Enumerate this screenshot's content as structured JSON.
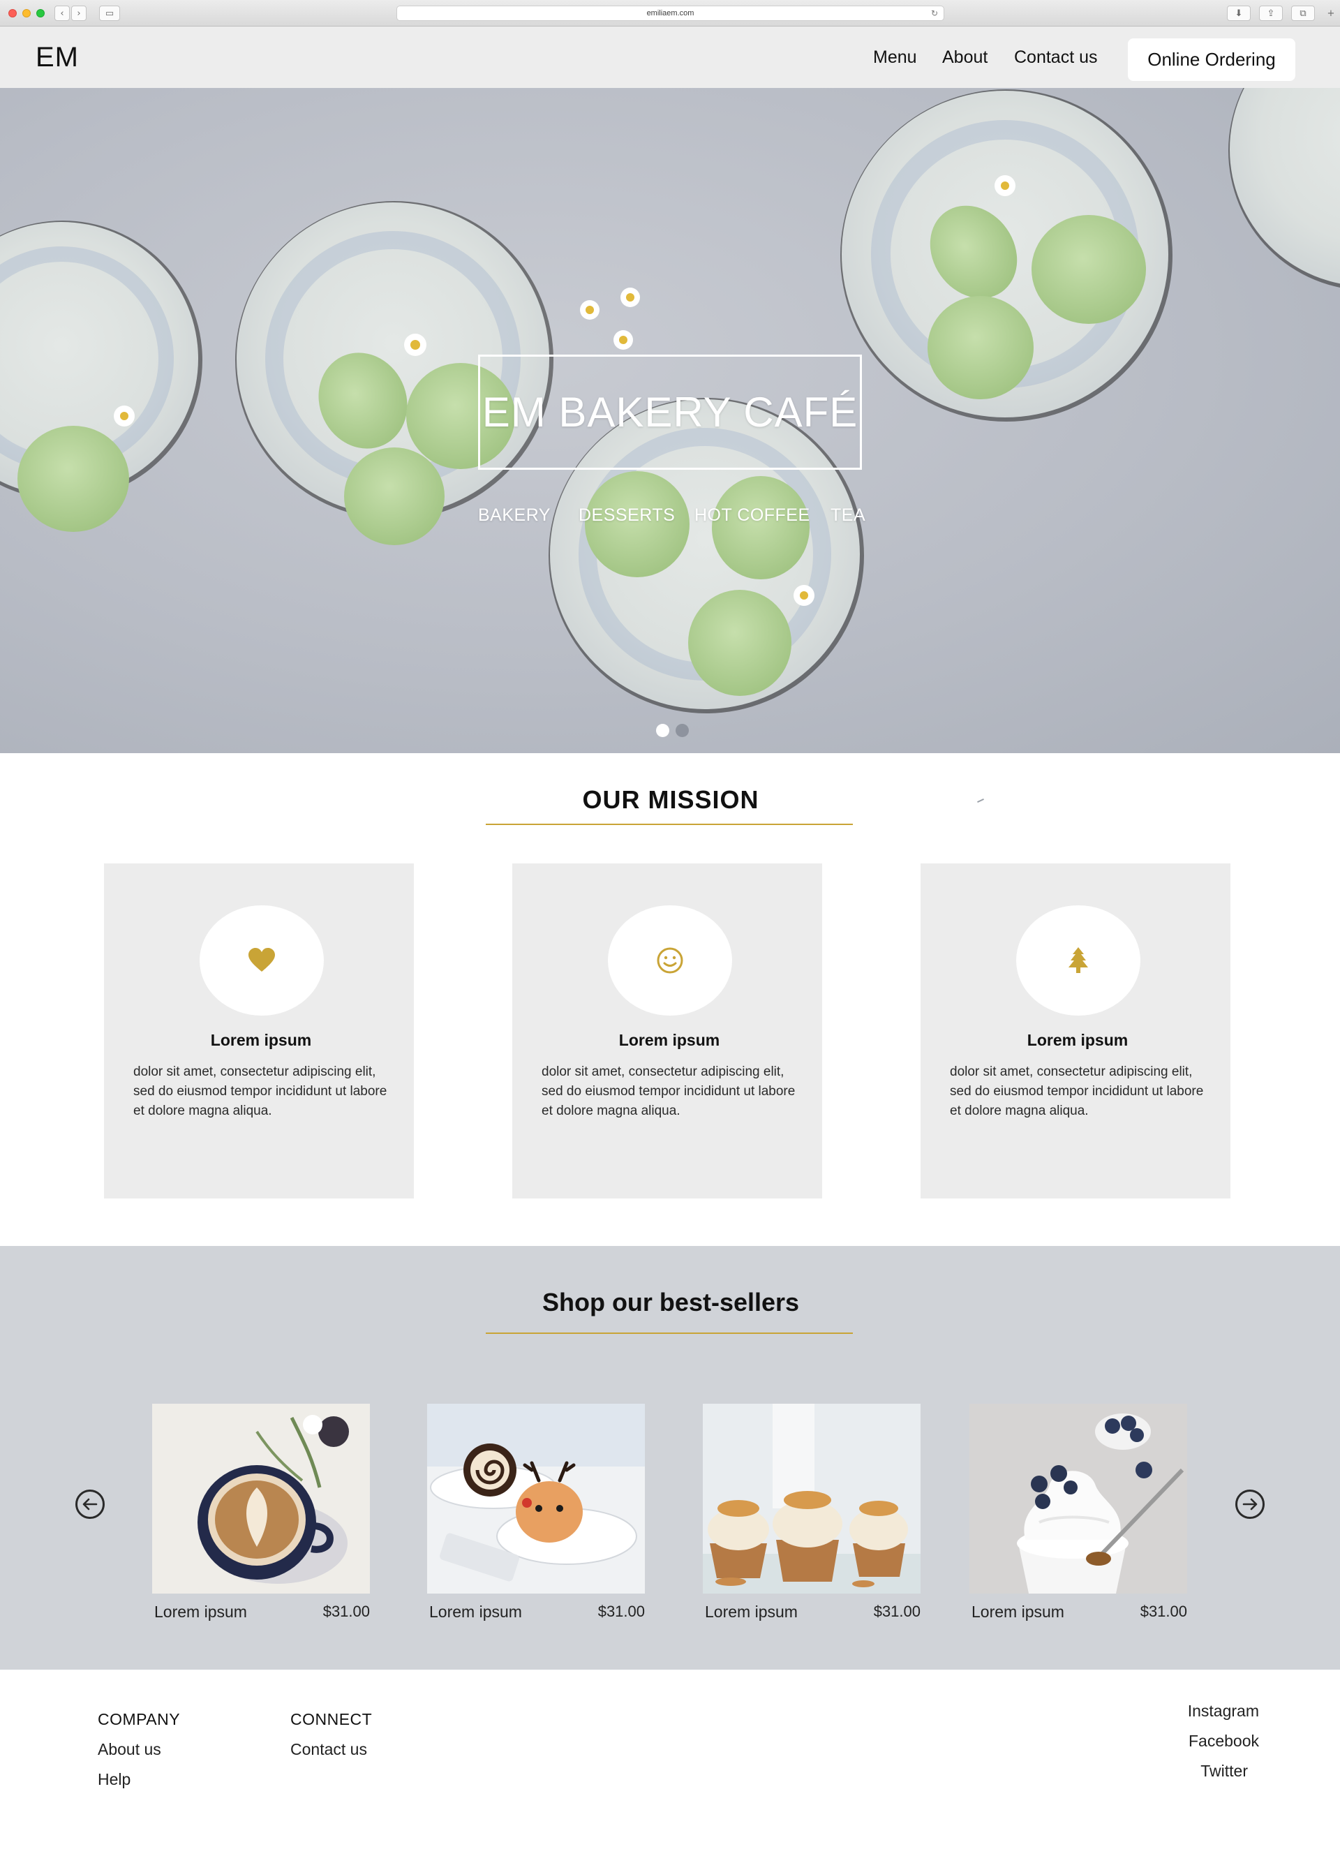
{
  "browser": {
    "url": "emiliaem.com"
  },
  "header": {
    "logo": "EM",
    "nav": [
      "Menu",
      "About",
      "Contact us"
    ],
    "cta": "Online Ordering"
  },
  "hero": {
    "title": "EM BAKERY CAFÉ",
    "categories": [
      "BAKERY",
      "DESSERTS",
      "HOT COFFEE",
      "TEA"
    ],
    "slide_count": 2,
    "active_slide": 1
  },
  "mission": {
    "title": "OUR MISSION",
    "cards": [
      {
        "icon": "heart-icon",
        "heading": "Lorem ipsum",
        "body": "dolor sit amet, consectetur adipiscing elit, sed do eiusmod tempor incididunt ut labore et dolore magna aliqua."
      },
      {
        "icon": "smiley-icon",
        "heading": "Lorem ipsum",
        "body": "dolor sit amet, consectetur adipiscing elit, sed do eiusmod tempor incididunt ut labore et dolore magna aliqua."
      },
      {
        "icon": "tree-icon",
        "heading": "Lorem ipsum",
        "body": "dolor sit amet, consectetur adipiscing elit, sed do eiusmod tempor incididunt ut labore et dolore magna aliqua."
      }
    ]
  },
  "sellers": {
    "title": "Shop our best-sellers",
    "products": [
      {
        "name": "Lorem ipsum",
        "price": "$31.00",
        "image": "latte-photo"
      },
      {
        "name": "Lorem ipsum",
        "price": "$31.00",
        "image": "cake-roll-photo"
      },
      {
        "name": "Lorem ipsum",
        "price": "$31.00",
        "image": "cupcakes-photo"
      },
      {
        "name": "Lorem ipsum",
        "price": "$31.00",
        "image": "blueberry-cupcake-photo"
      }
    ]
  },
  "footer": {
    "company": {
      "heading": "COMPANY",
      "links": [
        "About us",
        "Help"
      ]
    },
    "connect": {
      "heading": "CONNECT",
      "links": [
        "Contact us"
      ]
    },
    "social": [
      "Instagram",
      "Facebook",
      "Twitter"
    ]
  },
  "colors": {
    "accent_gold": "#c9a436",
    "header_bg": "#ededed",
    "card_bg": "#ececec",
    "sellers_bg": "#d0d3d8",
    "macaron_green": "#b5d39a"
  }
}
